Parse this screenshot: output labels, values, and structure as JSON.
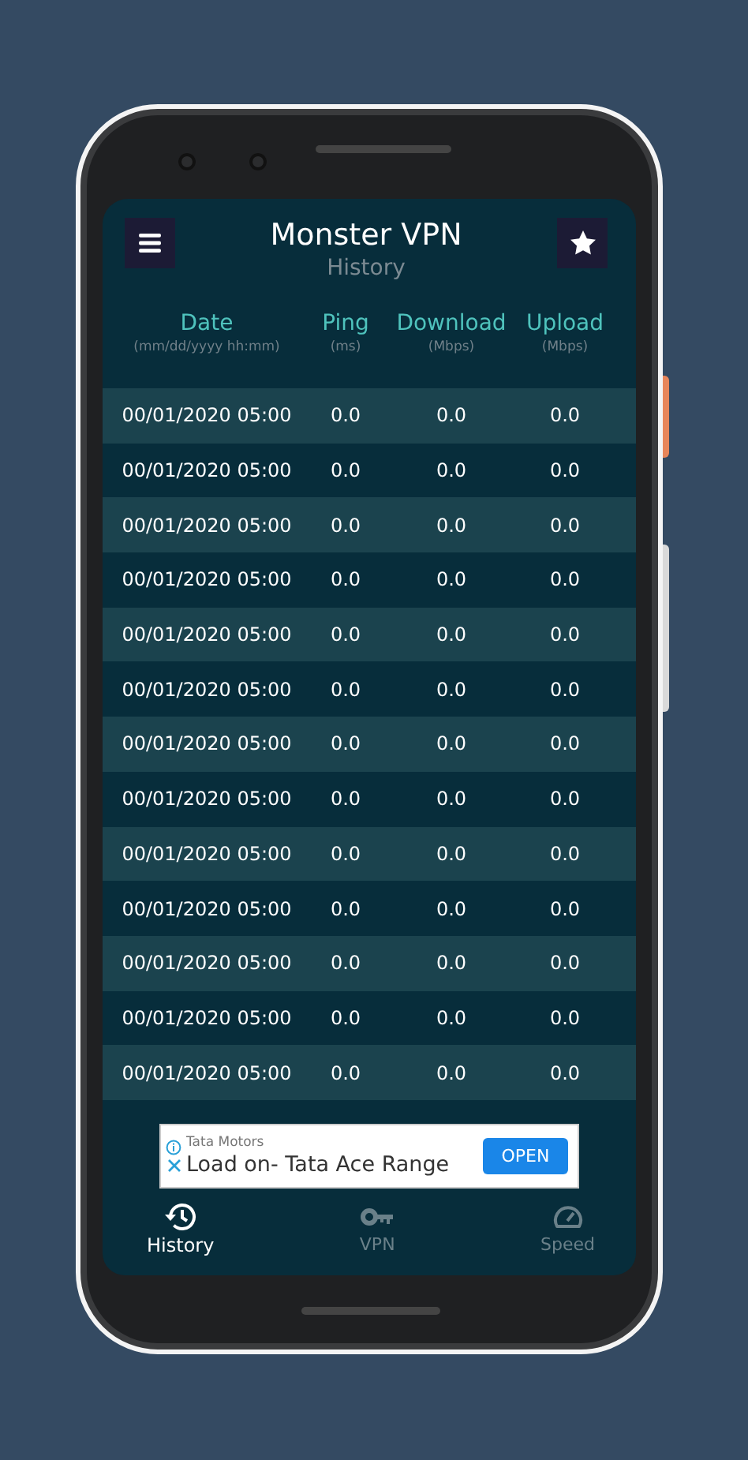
{
  "header": {
    "title": "Monster VPN",
    "subtitle": "History"
  },
  "columns": [
    {
      "label": "Date",
      "unit": "(mm/dd/yyyy hh:mm)"
    },
    {
      "label": "Ping",
      "unit": "(ms)"
    },
    {
      "label": "Download",
      "unit": "(Mbps)"
    },
    {
      "label": "Upload",
      "unit": "(Mbps)"
    }
  ],
  "rows": [
    {
      "date": "00/01/2020 05:00",
      "ping": "0.0",
      "download": "0.0",
      "upload": "0.0"
    },
    {
      "date": "00/01/2020 05:00",
      "ping": "0.0",
      "download": "0.0",
      "upload": "0.0"
    },
    {
      "date": "00/01/2020 05:00",
      "ping": "0.0",
      "download": "0.0",
      "upload": "0.0"
    },
    {
      "date": "00/01/2020 05:00",
      "ping": "0.0",
      "download": "0.0",
      "upload": "0.0"
    },
    {
      "date": "00/01/2020 05:00",
      "ping": "0.0",
      "download": "0.0",
      "upload": "0.0"
    },
    {
      "date": "00/01/2020 05:00",
      "ping": "0.0",
      "download": "0.0",
      "upload": "0.0"
    },
    {
      "date": "00/01/2020 05:00",
      "ping": "0.0",
      "download": "0.0",
      "upload": "0.0"
    },
    {
      "date": "00/01/2020 05:00",
      "ping": "0.0",
      "download": "0.0",
      "upload": "0.0"
    },
    {
      "date": "00/01/2020 05:00",
      "ping": "0.0",
      "download": "0.0",
      "upload": "0.0"
    },
    {
      "date": "00/01/2020 05:00",
      "ping": "0.0",
      "download": "0.0",
      "upload": "0.0"
    },
    {
      "date": "00/01/2020 05:00",
      "ping": "0.0",
      "download": "0.0",
      "upload": "0.0"
    },
    {
      "date": "00/01/2020 05:00",
      "ping": "0.0",
      "download": "0.0",
      "upload": "0.0"
    },
    {
      "date": "00/01/2020 05:00",
      "ping": "0.0",
      "download": "0.0",
      "upload": "0.0"
    }
  ],
  "ad": {
    "advertiser": "Tata Motors",
    "headline": "Load on- Tata Ace Range",
    "button": "OPEN"
  },
  "nav": [
    {
      "kind": "history",
      "label": "History",
      "selected": true
    },
    {
      "kind": "vpn",
      "label": "VPN",
      "selected": false
    },
    {
      "kind": "speed",
      "label": "Speed",
      "selected": false
    }
  ]
}
